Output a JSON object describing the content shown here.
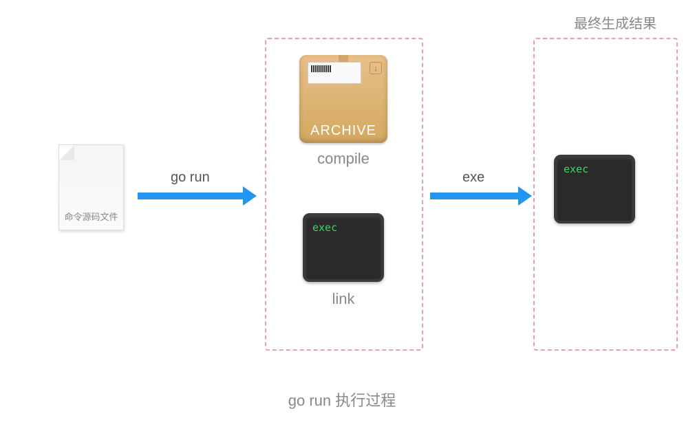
{
  "file": {
    "label": "命令源码文件"
  },
  "arrows": {
    "first": "go run",
    "second": "exe"
  },
  "middle": {
    "archive_text": "ARCHIVE",
    "compile_label": "compile",
    "terminal_text": "exec",
    "link_label": "link"
  },
  "right": {
    "title": "最终生成结果",
    "terminal_text": "exec"
  },
  "caption": "go run 执行过程"
}
